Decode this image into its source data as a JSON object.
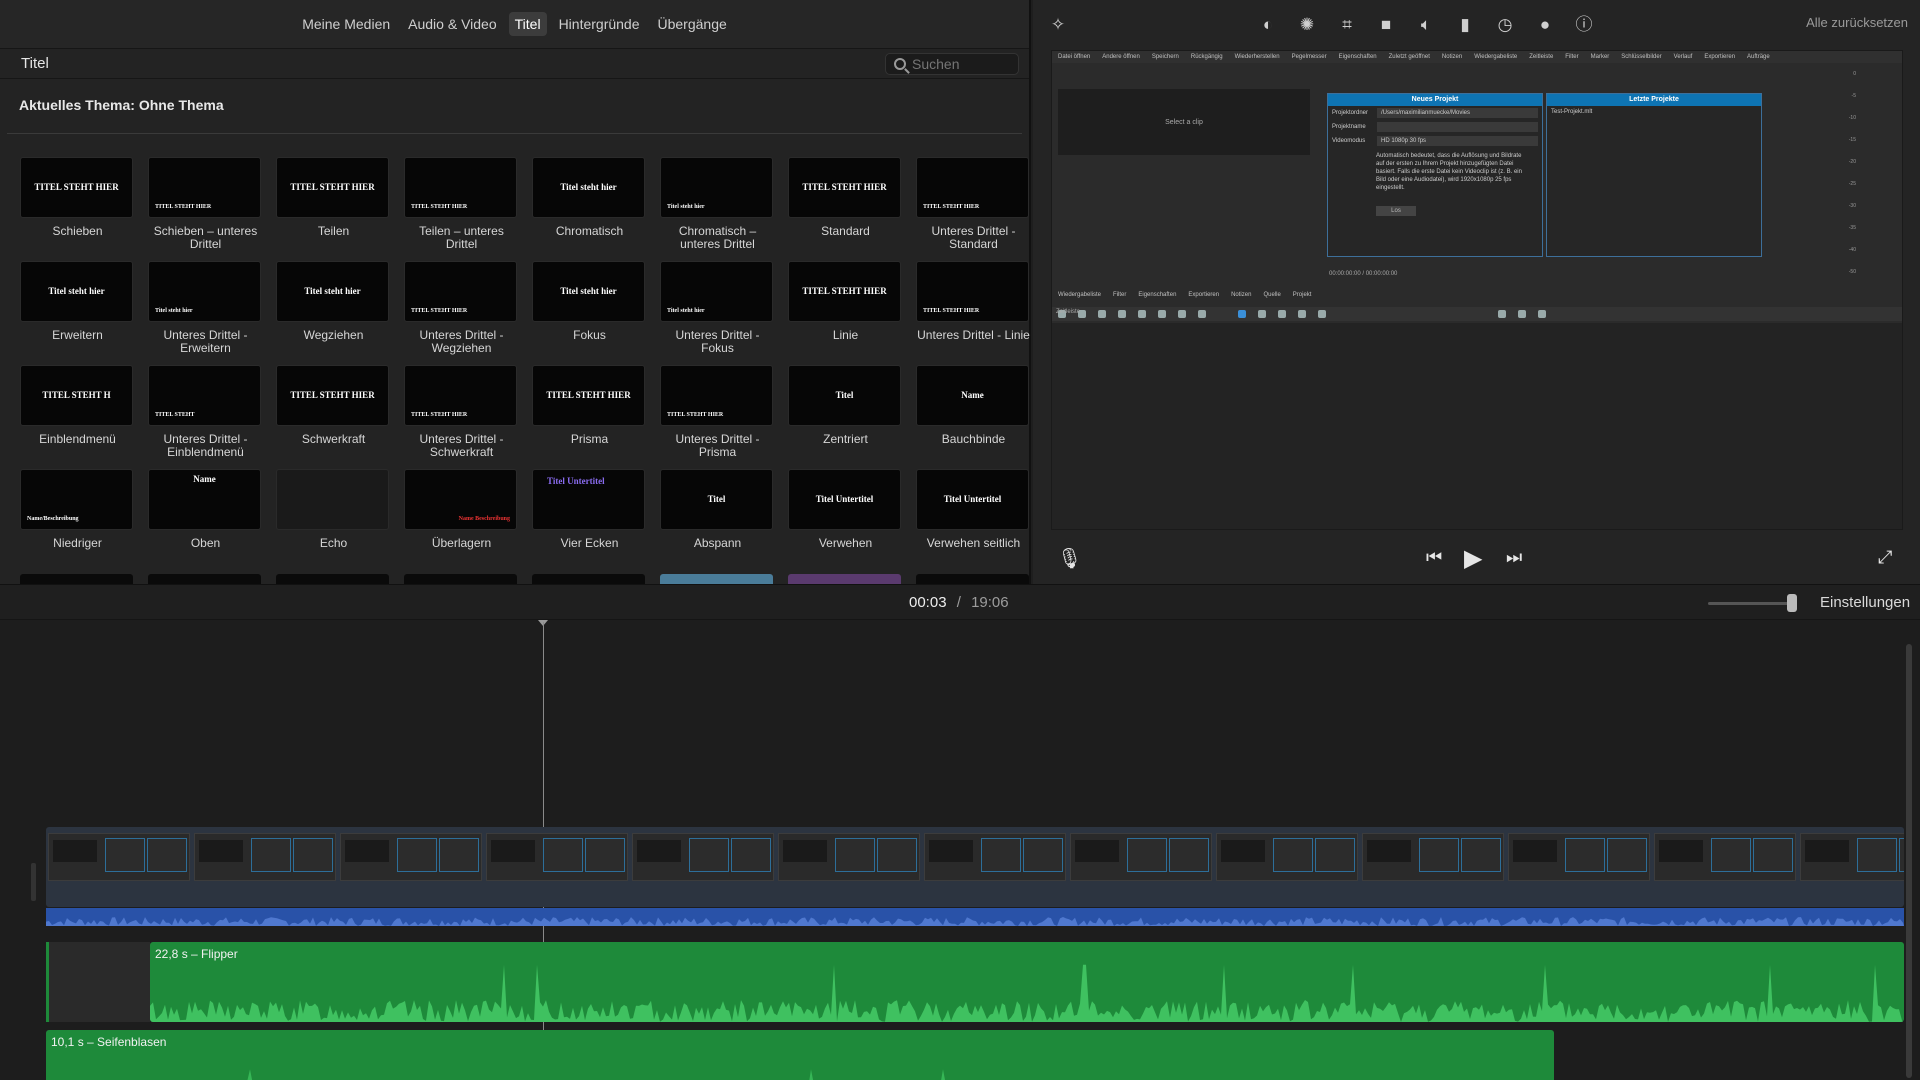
{
  "browser": {
    "tabs": [
      {
        "label": "Meine Medien",
        "active": false
      },
      {
        "label": "Audio & Video",
        "active": false
      },
      {
        "label": "Titel",
        "active": true
      },
      {
        "label": "Hintergründe",
        "active": false
      },
      {
        "label": "Übergänge",
        "active": false
      }
    ],
    "section_title": "Titel",
    "search_placeholder": "Suchen",
    "theme_label": "Aktuelles Thema: Ohne Thema",
    "titles": [
      {
        "label": "Schieben",
        "thumb_text": "TITEL STEHT HIER"
      },
      {
        "label": "Schieben – unteres Drittel",
        "thumb_text": "TITEL STEHT HIER"
      },
      {
        "label": "Teilen",
        "thumb_text": "TITEL STEHT HIER"
      },
      {
        "label": "Teilen – unteres Drittel",
        "thumb_text": "TITEL STEHT HIER"
      },
      {
        "label": "Chromatisch",
        "thumb_text": "Titel steht hier"
      },
      {
        "label": "Chromatisch – unteres Drittel",
        "thumb_text": "Titel steht hier"
      },
      {
        "label": "Standard",
        "thumb_text": "TITEL STEHT HIER"
      },
      {
        "label": "Unteres Drittel - Standard",
        "thumb_text": "TITEL STEHT HIER"
      },
      {
        "label": "Erweitern",
        "thumb_text": "Titel steht hier"
      },
      {
        "label": "Unteres Drittel - Erweitern",
        "thumb_text": "Titel steht hier"
      },
      {
        "label": "Wegziehen",
        "thumb_text": "Titel steht hier"
      },
      {
        "label": "Unteres Drittel - Wegziehen",
        "thumb_text": "TITEL STEHT HIER"
      },
      {
        "label": "Fokus",
        "thumb_text": "Titel steht hier"
      },
      {
        "label": "Unteres Drittel - Fokus",
        "thumb_text": "Titel steht hier"
      },
      {
        "label": "Linie",
        "thumb_text": "TITEL STEHT HIER"
      },
      {
        "label": "Unteres Drittel - Linie",
        "thumb_text": "TITEL STEHT HIER"
      },
      {
        "label": "Einblendmenü",
        "thumb_text": "TITEL STEHT H"
      },
      {
        "label": "Unteres Drittel - Einblendmenü",
        "thumb_text": "TITEL STEHT"
      },
      {
        "label": "Schwerkraft",
        "thumb_text": "TITEL STEHT HIER"
      },
      {
        "label": "Unteres Drittel - Schwerkraft",
        "thumb_text": "TITEL STEHT HIER"
      },
      {
        "label": "Prisma",
        "thumb_text": "TITEL STEHT HIER"
      },
      {
        "label": "Unteres Drittel - Prisma",
        "thumb_text": "TITEL STEHT HIER"
      },
      {
        "label": "Zentriert",
        "thumb_text": "Titel"
      },
      {
        "label": "Bauchbinde",
        "thumb_text": "Name"
      },
      {
        "label": "Niedriger",
        "thumb_text": "Name/Beschreibung"
      },
      {
        "label": "Oben",
        "thumb_text": "Name"
      },
      {
        "label": "Echo",
        "thumb_text": ""
      },
      {
        "label": "Überlagern",
        "thumb_text": "Name Beschreibung"
      },
      {
        "label": "Vier Ecken",
        "thumb_text": "Titel Untertitel"
      },
      {
        "label": "Abspann",
        "thumb_text": "Titel"
      },
      {
        "label": "Verwehen",
        "thumb_text": "Titel Untertitel"
      },
      {
        "label": "Verwehen seitlich",
        "thumb_text": "Titel Untertitel"
      }
    ]
  },
  "viewer": {
    "reset_all": "Alle zurücksetzen",
    "toolbar_icons": [
      "magic-wand-icon",
      "color-balance-icon",
      "color-correction-icon",
      "crop-icon",
      "stabilization-icon",
      "volume-icon",
      "equalizer-icon",
      "speed-icon",
      "clip-filter-icon",
      "info-icon"
    ],
    "preview": {
      "menu": [
        "Datei öffnen",
        "Andere öffnen",
        "Speichern",
        "Rückgängig",
        "Wiederherstellen",
        "Pegelmesser",
        "Eigenschaften",
        "Zuletzt geöffnet",
        "Notizen",
        "Wiedergabeliste",
        "Zeitleiste",
        "Filter",
        "Marker",
        "Schlüsselbilder",
        "Verlauf",
        "Exportieren",
        "Aufträge"
      ],
      "select_clip": "Select a clip",
      "new_project_header": "Neues Projekt",
      "project_folder_label": "Projektordner",
      "project_folder_value": "/Users/maximilianmuecke/Movies",
      "project_name_label": "Projektname",
      "video_mode_label": "Videomodus",
      "video_mode_value": "HD 1080p 30 fps",
      "description": "Automatisch bedeutet, dass die Auflösung und Bildrate auf der ersten zu Ihrem Projekt hinzugefügten Datei basiert. Falls die erste Datei kein Videoclip ist (z. B. ein Bild oder eine Audiodatei), wird 1920x1080p 25 fps eingestellt.",
      "start_button": "Los",
      "last_projects_header": "Letzte Projekte",
      "last_project_item": "Test-Projekt.mlt",
      "timecode": "00:00:00:00 / 00:00:00:00",
      "lower_menu": [
        "Wiedergabeliste",
        "Filter",
        "Eigenschaften",
        "Exportieren",
        "Notizen",
        "Quelle",
        "Projekt"
      ],
      "timeline_label": "Zeitleiste",
      "db_scale": [
        "0",
        "-5",
        "-10",
        "-15",
        "-20",
        "-25",
        "-30",
        "-35",
        "-40",
        "-50"
      ]
    }
  },
  "timeline": {
    "current_time": "00:03",
    "separator": "/",
    "total_time": "19:06",
    "settings_label": "Einstellungen",
    "clips": [
      {
        "label": "22,8 s – Flipper"
      },
      {
        "label": "10,1 s – Seifenblasen"
      }
    ]
  },
  "colors": {
    "accent_blue": "#0e74b3",
    "audio_green": "#1e8a3a",
    "waveform_blue": "#2952a8"
  }
}
